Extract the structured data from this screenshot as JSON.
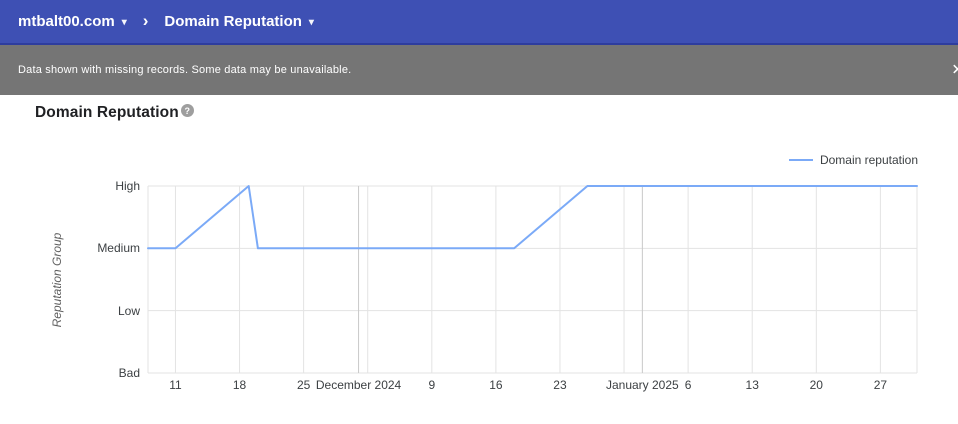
{
  "icons": {
    "back": "‹",
    "caret": "▾",
    "separator": "›",
    "close": "✕",
    "help": "?"
  },
  "header": {
    "domain": "mtbalt00.com",
    "page": "Domain Reputation"
  },
  "banner": {
    "message": "Data shown with missing records. Some data may be unavailable."
  },
  "main": {
    "title": "Domain Reputation"
  },
  "colors": {
    "appbar": "#3e50b4",
    "banner": "#757575",
    "line": "#7baaf7",
    "grid": "#e3e3e3",
    "month_grid": "#c9c9c9"
  },
  "chart_data": {
    "type": "line",
    "title": "Domain Reputation",
    "ylabel": "Reputation Group",
    "y_categories": [
      "Bad",
      "Low",
      "Medium",
      "High"
    ],
    "y_value_map": {
      "Bad": 0,
      "Low": 1,
      "Medium": 2,
      "High": 3
    },
    "x_range": {
      "start": "2024-11-08",
      "end": "2025-01-31",
      "days": 84
    },
    "x_axis": {
      "ticks": [
        {
          "day": 3,
          "label": "11"
        },
        {
          "day": 10,
          "label": "18"
        },
        {
          "day": 17,
          "label": "25"
        },
        {
          "day": 24,
          "label": ""
        },
        {
          "day": 31,
          "label": "9"
        },
        {
          "day": 38,
          "label": "16"
        },
        {
          "day": 45,
          "label": "23"
        },
        {
          "day": 52,
          "label": ""
        },
        {
          "day": 59,
          "label": "6"
        },
        {
          "day": 66,
          "label": "13"
        },
        {
          "day": 73,
          "label": "20"
        },
        {
          "day": 80,
          "label": "27"
        }
      ],
      "months": [
        {
          "day": 23,
          "label": "December 2024"
        },
        {
          "day": 54,
          "label": "January 2025"
        }
      ]
    },
    "legend": [
      {
        "label": "Domain reputation",
        "color": "#7baaf7"
      }
    ],
    "legend_position": "top-right",
    "grid": true,
    "series": [
      {
        "name": "Domain reputation",
        "color": "#7baaf7",
        "points": [
          {
            "day": 0,
            "date": "2024-11-08",
            "value": "Medium"
          },
          {
            "day": 3,
            "date": "2024-11-11",
            "value": "Medium"
          },
          {
            "day": 11,
            "date": "2024-11-19",
            "value": "High"
          },
          {
            "day": 12,
            "date": "2024-11-20",
            "value": "Medium"
          },
          {
            "day": 40,
            "date": "2024-12-18",
            "value": "Medium"
          },
          {
            "day": 48,
            "date": "2024-12-26",
            "value": "High"
          },
          {
            "day": 84,
            "date": "2025-01-31",
            "value": "High"
          }
        ]
      }
    ]
  }
}
